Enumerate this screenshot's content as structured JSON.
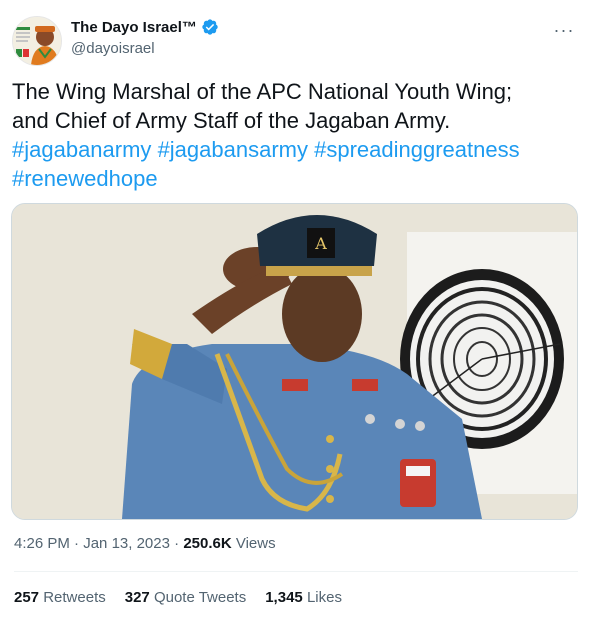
{
  "author": {
    "display_name": "The Dayo Israel™",
    "handle": "@dayoisrael",
    "verified_icon": "verified-badge-icon"
  },
  "tweet": {
    "line1": "The Wing Marshal of the APC National Youth Wing;",
    "line2": "and Chief of Army Staff of the Jagaban Army.",
    "hashtags_line1": [
      "#jagabanarmy",
      "#jagabansarmy",
      "#spreadinggreatness"
    ],
    "hashtags_line2": [
      "#renewedhope"
    ]
  },
  "media": {
    "alt_description_icon": "photo-icon",
    "cap_badge_text": "A"
  },
  "meta": {
    "time": "4:26 PM",
    "sep1": " · ",
    "date": "Jan 13, 2023",
    "sep2": " · ",
    "views_count": "250.6K",
    "views_label": " Views"
  },
  "stats": {
    "retweets_count": "257",
    "retweets_label": "Retweets",
    "quotes_count": "327",
    "quotes_label": "Quote Tweets",
    "likes_count": "1,345",
    "likes_label": "Likes"
  },
  "colors": {
    "link": "#1d9bf0",
    "verified": "#1d9bf0",
    "secondary_text": "#536471"
  }
}
